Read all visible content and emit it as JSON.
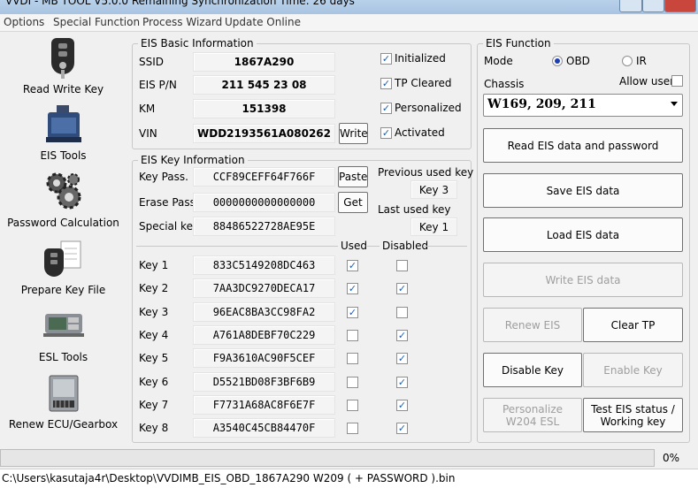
{
  "window": {
    "title": "VVDI - MB TOOL V5.0.0   Remaining Synchronization Time: 26 days"
  },
  "menu": [
    "Options",
    "Special Function",
    "Process Wizard",
    "Update Online"
  ],
  "sidebar": [
    {
      "label": "Read Write Key",
      "icon": "car-key-icon"
    },
    {
      "label": "EIS Tools",
      "icon": "eis-module-icon"
    },
    {
      "label": "Password Calculation",
      "icon": "gears-icon"
    },
    {
      "label": "Prepare Key File",
      "icon": "key-document-icon"
    },
    {
      "label": "ESL Tools",
      "icon": "esl-board-icon"
    },
    {
      "label": "Renew ECU/Gearbox",
      "icon": "ecu-module-icon"
    }
  ],
  "eis_basic": {
    "title": "EIS Basic Information",
    "ssid_label": "SSID",
    "ssid": "1867A290",
    "pn_label": "EIS P/N",
    "pn": "211 545 23 08",
    "km_label": "KM",
    "km": "151398",
    "vin_label": "VIN",
    "vin": "WDD2193561A080262",
    "write_btn": "Write",
    "flags": [
      {
        "label": "Initialized",
        "checked": true
      },
      {
        "label": "TP Cleared",
        "checked": true
      },
      {
        "label": "Personalized",
        "checked": true
      },
      {
        "label": "Activated",
        "checked": true
      }
    ]
  },
  "eis_key": {
    "title": "EIS Key Information",
    "keypass_label": "Key Pass.",
    "keypass": "CCF89CEFF64F766F",
    "paste_btn": "Paste",
    "erase_label": "Erase Pass.",
    "erase": "0000000000000000",
    "get_btn": "Get",
    "special_label": "Special key",
    "special": "88486522728AE95E",
    "prev_label": "Previous used key",
    "prev": "Key 3",
    "last_label": "Last used key",
    "last": "Key 1",
    "used_label": "Used",
    "disabled_label": "Disabled",
    "keys": [
      {
        "label": "Key 1",
        "value": "833C5149208DC463",
        "used": true,
        "disabled": false
      },
      {
        "label": "Key 2",
        "value": "7AA3DC9270DECA17",
        "used": true,
        "disabled": true
      },
      {
        "label": "Key 3",
        "value": "96EAC8BA3CC98FA2",
        "used": true,
        "disabled": false
      },
      {
        "label": "Key 4",
        "value": "A761A8DEBF70C229",
        "used": false,
        "disabled": true
      },
      {
        "label": "Key 5",
        "value": "F9A3610AC90F5CEF",
        "used": false,
        "disabled": true
      },
      {
        "label": "Key 6",
        "value": "D5521BD08F3BF6B9",
        "used": false,
        "disabled": true
      },
      {
        "label": "Key 7",
        "value": "F7731A68AC8F6E7F",
        "used": false,
        "disabled": true
      },
      {
        "label": "Key 8",
        "value": "A3540C45CB84470F",
        "used": false,
        "disabled": true
      }
    ]
  },
  "eis_function": {
    "title": "EIS Function",
    "mode_label": "Mode",
    "mode_obd": "OBD",
    "mode_ir": "IR",
    "mode_selected": "OBD",
    "chassis_label": "Chassis",
    "allow_user": "Allow user",
    "chassis_value": "W169, 209, 211",
    "buttons": {
      "read": "Read EIS data and password",
      "save": "Save EIS data",
      "load": "Load EIS data",
      "write": "Write EIS data",
      "renew": "Renew EIS",
      "clear_tp": "Clear TP",
      "disable_key": "Disable Key",
      "enable_key": "Enable Key",
      "personalize": "Personalize W204 ESL",
      "test": "Test EIS status / Working key"
    }
  },
  "progress": {
    "value": 0,
    "text": "0%"
  },
  "status": "C:\\Users\\kasutaja4r\\Desktop\\VVDIMB_EIS_OBD_1867A290  W209 ( + PASSWORD ).bin",
  "colors": {
    "accent": "#1e5fb4",
    "titlebar": "#b9d1ea"
  }
}
